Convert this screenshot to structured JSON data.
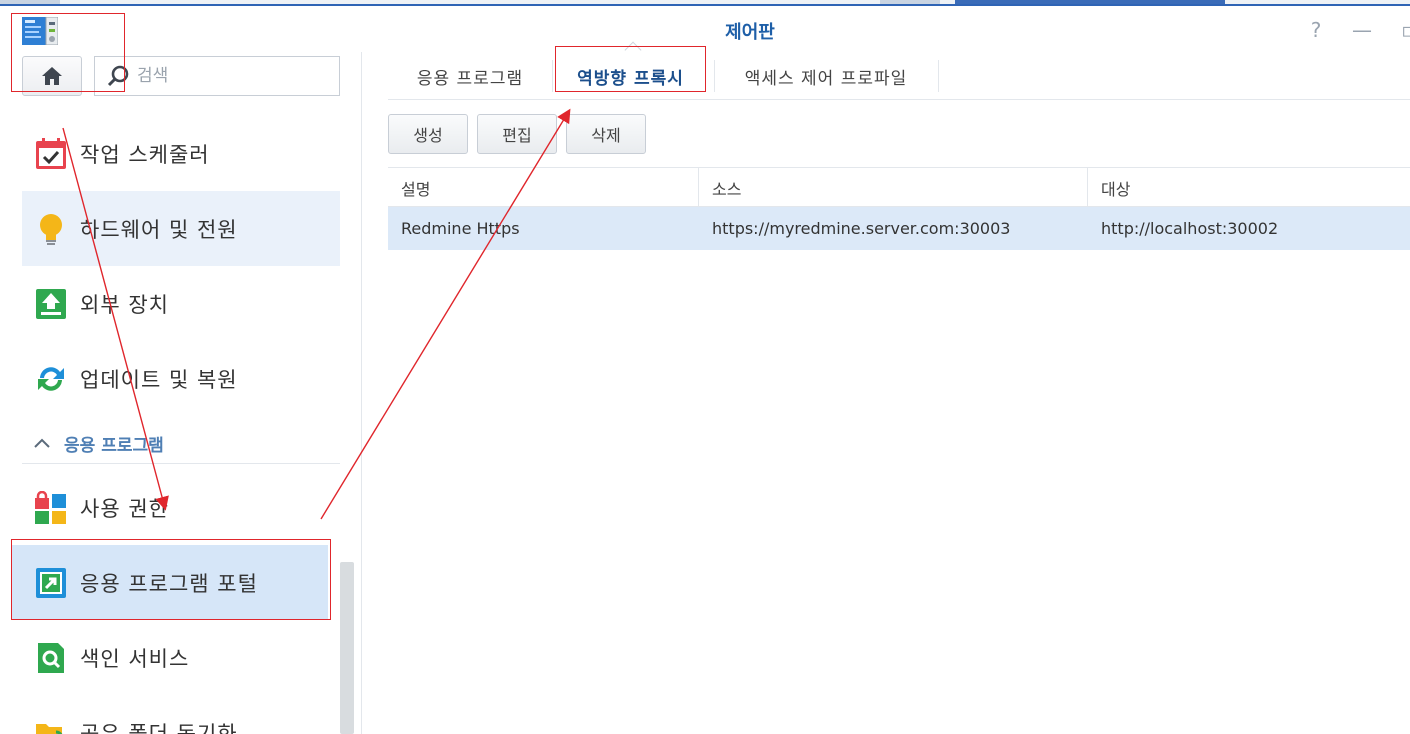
{
  "window": {
    "title": "제어판",
    "help_icon": "help-icon",
    "minimize_icon": "minimize-icon",
    "restore_icon": "restore-icon"
  },
  "sidebar": {
    "search_placeholder": "검색",
    "items_top": [
      {
        "label": "작업 스케줄러",
        "icon": "task-scheduler-icon"
      },
      {
        "label": "하드웨어 및 전원",
        "icon": "lightbulb-icon"
      },
      {
        "label": "외부 장치",
        "icon": "external-device-icon"
      },
      {
        "label": "업데이트 및 복원",
        "icon": "update-restore-icon"
      }
    ],
    "section_label": "응용 프로그램",
    "items_apps": [
      {
        "label": "사용 권한",
        "icon": "privileges-icon"
      },
      {
        "label": "응용 프로그램 포털",
        "icon": "application-portal-icon"
      },
      {
        "label": "색인 서비스",
        "icon": "indexing-service-icon"
      },
      {
        "label": "공유 폴더 동기화",
        "icon": "shared-folder-sync-icon"
      }
    ]
  },
  "tabs": [
    {
      "label": "응용 프로그램"
    },
    {
      "label": "역방향 프록시"
    },
    {
      "label": "액세스 제어 프로파일"
    }
  ],
  "toolbar": {
    "create": "생성",
    "edit": "편집",
    "delete": "삭제"
  },
  "table": {
    "columns": [
      "설명",
      "소스",
      "대상"
    ],
    "rows": [
      [
        "Redmine Https",
        "https://myredmine.server.com:30003",
        "http://localhost:30002"
      ]
    ]
  },
  "colors": {
    "accent": "#1e5fa8",
    "selected_row": "#dce9f8",
    "annotation": "#e0262c"
  }
}
